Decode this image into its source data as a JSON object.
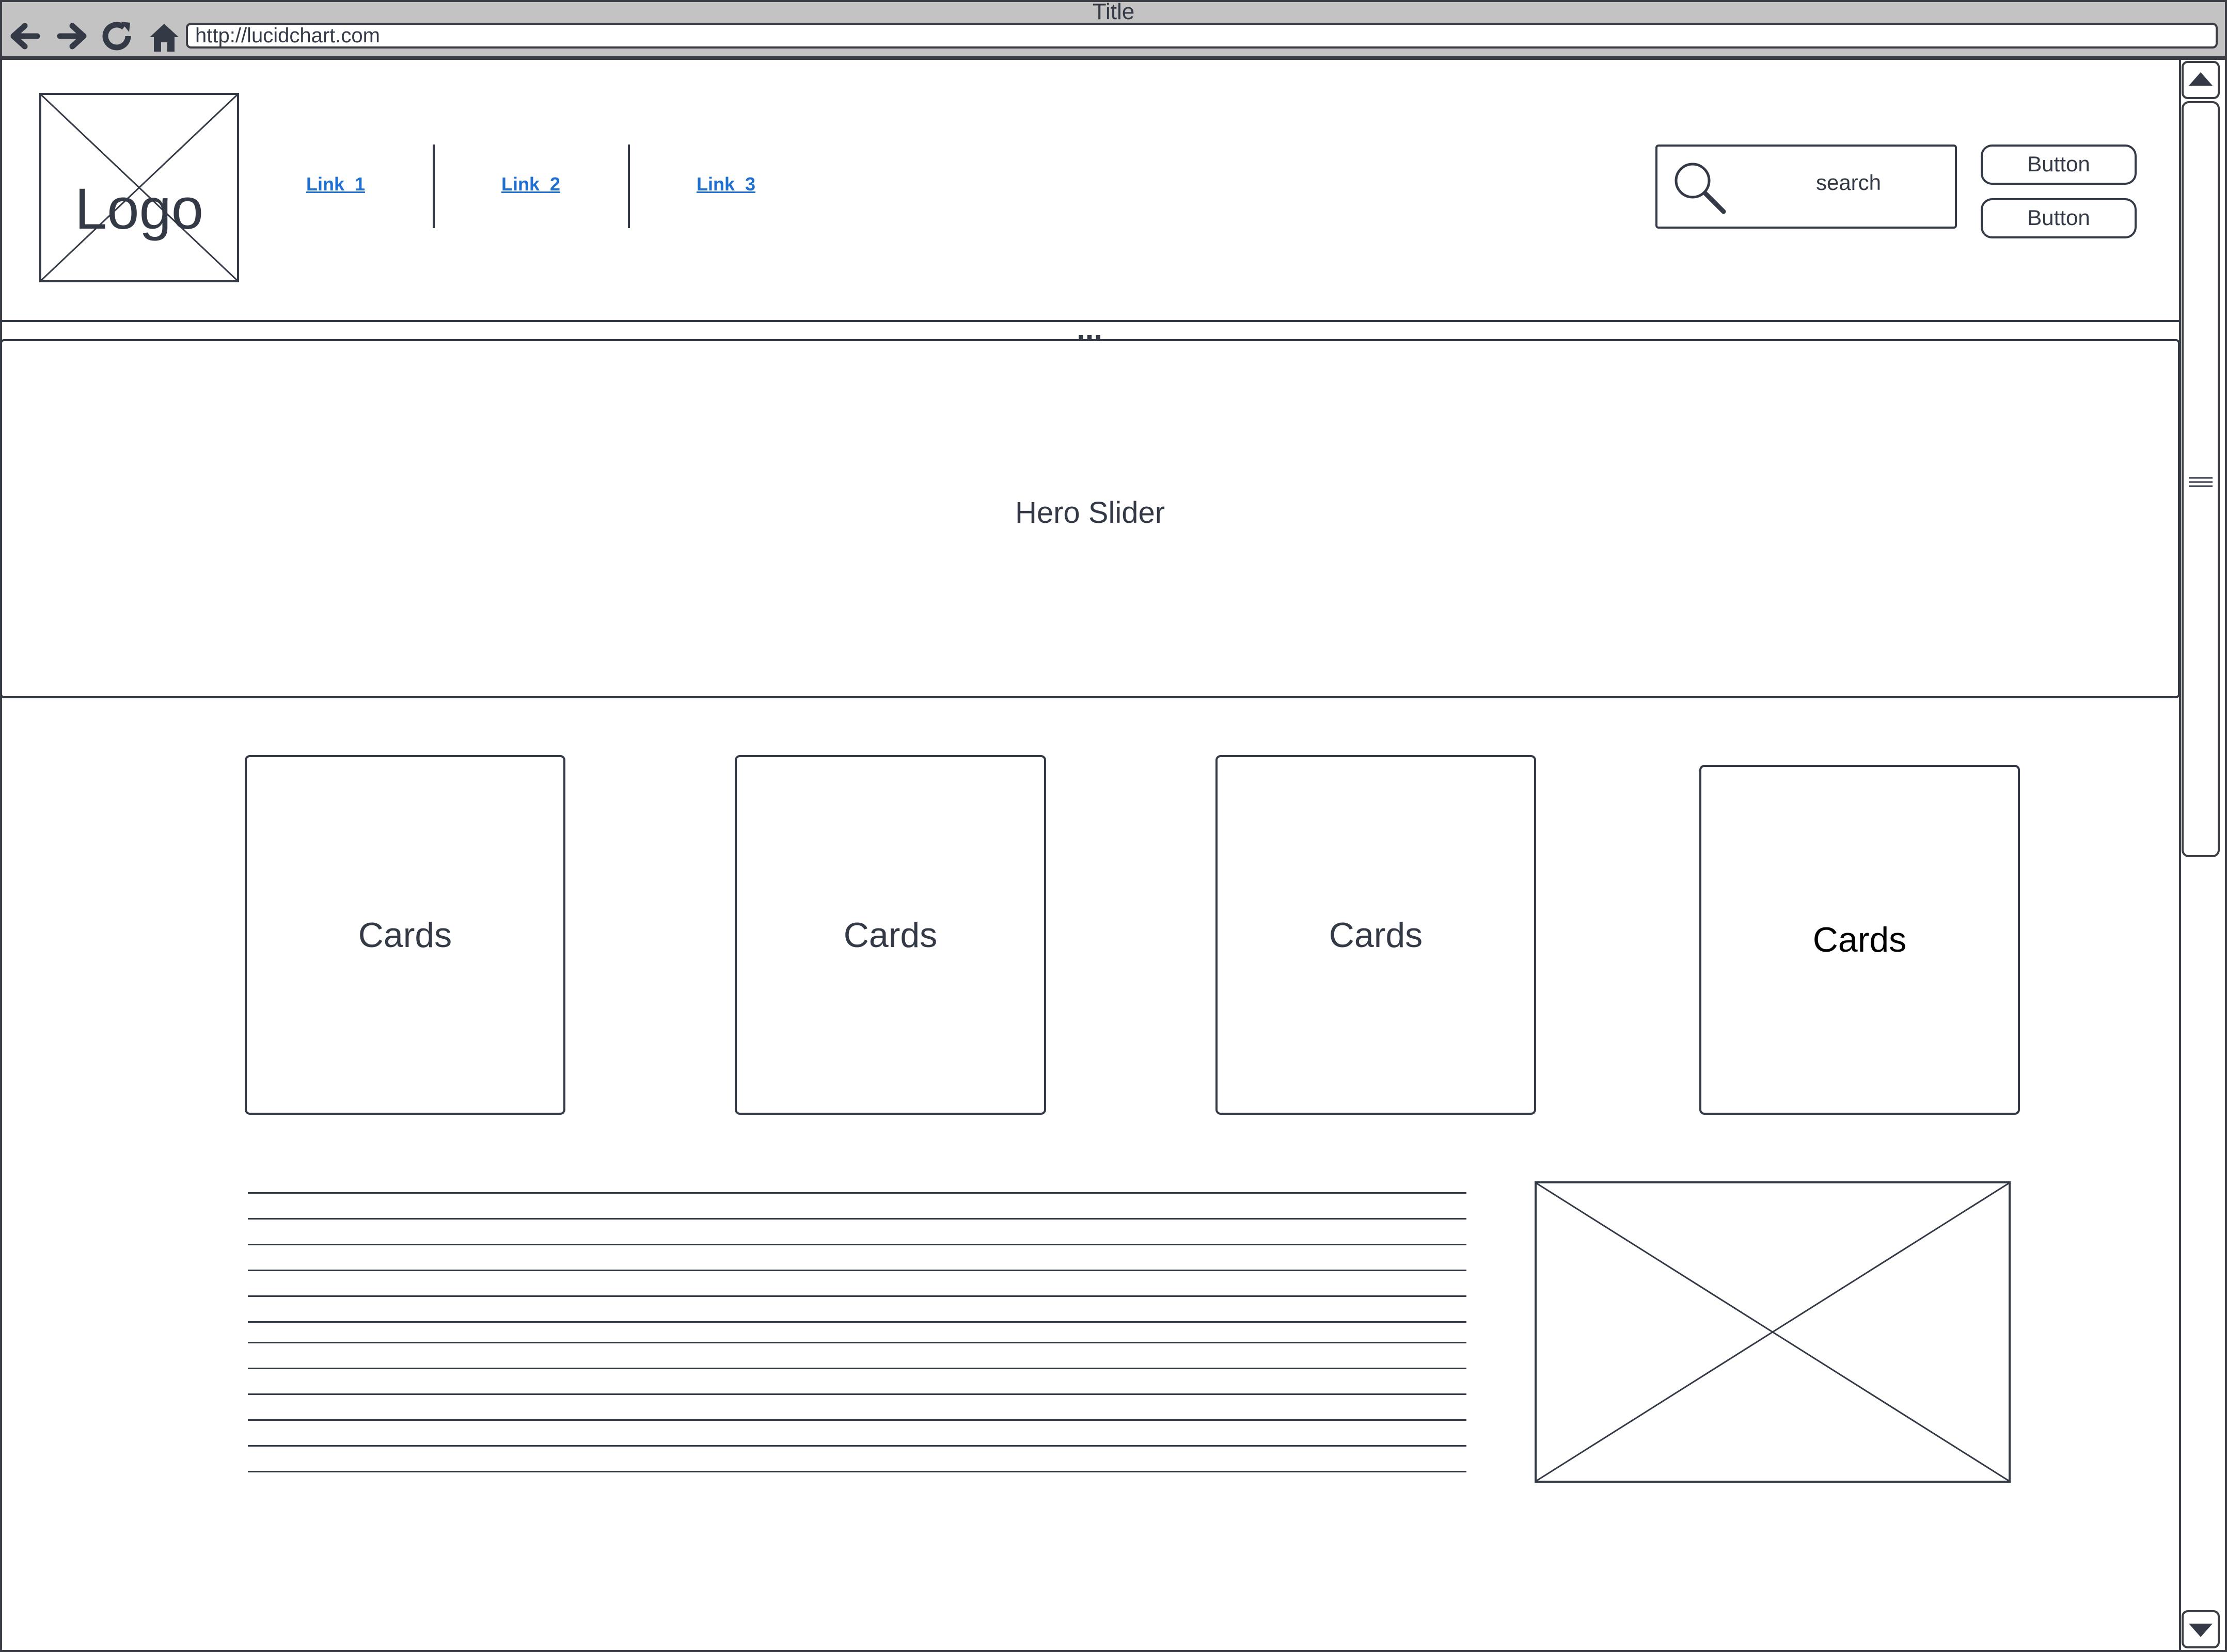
{
  "window": {
    "title": "Title"
  },
  "browser": {
    "url": "http://lucidchart.com",
    "nav_icons": [
      "back-arrow-icon",
      "forward-arrow-icon",
      "reload-icon",
      "home-icon"
    ]
  },
  "header": {
    "logo_text": "Logo",
    "nav_links": [
      "Link_1",
      "Link_2",
      "Link_3"
    ],
    "search_placeholder": "search",
    "buttons": [
      "Button",
      "Button"
    ],
    "more_indicator": "..."
  },
  "hero": {
    "label": "Hero Slider"
  },
  "cards": [
    "Cards",
    "Cards",
    "Cards",
    "Cards"
  ],
  "content": {
    "text_line_count": 12
  },
  "colors": {
    "chrome": "#c3c3c3",
    "stroke": "#333a45",
    "link": "#1f6fd1",
    "background": "#ffffff"
  }
}
